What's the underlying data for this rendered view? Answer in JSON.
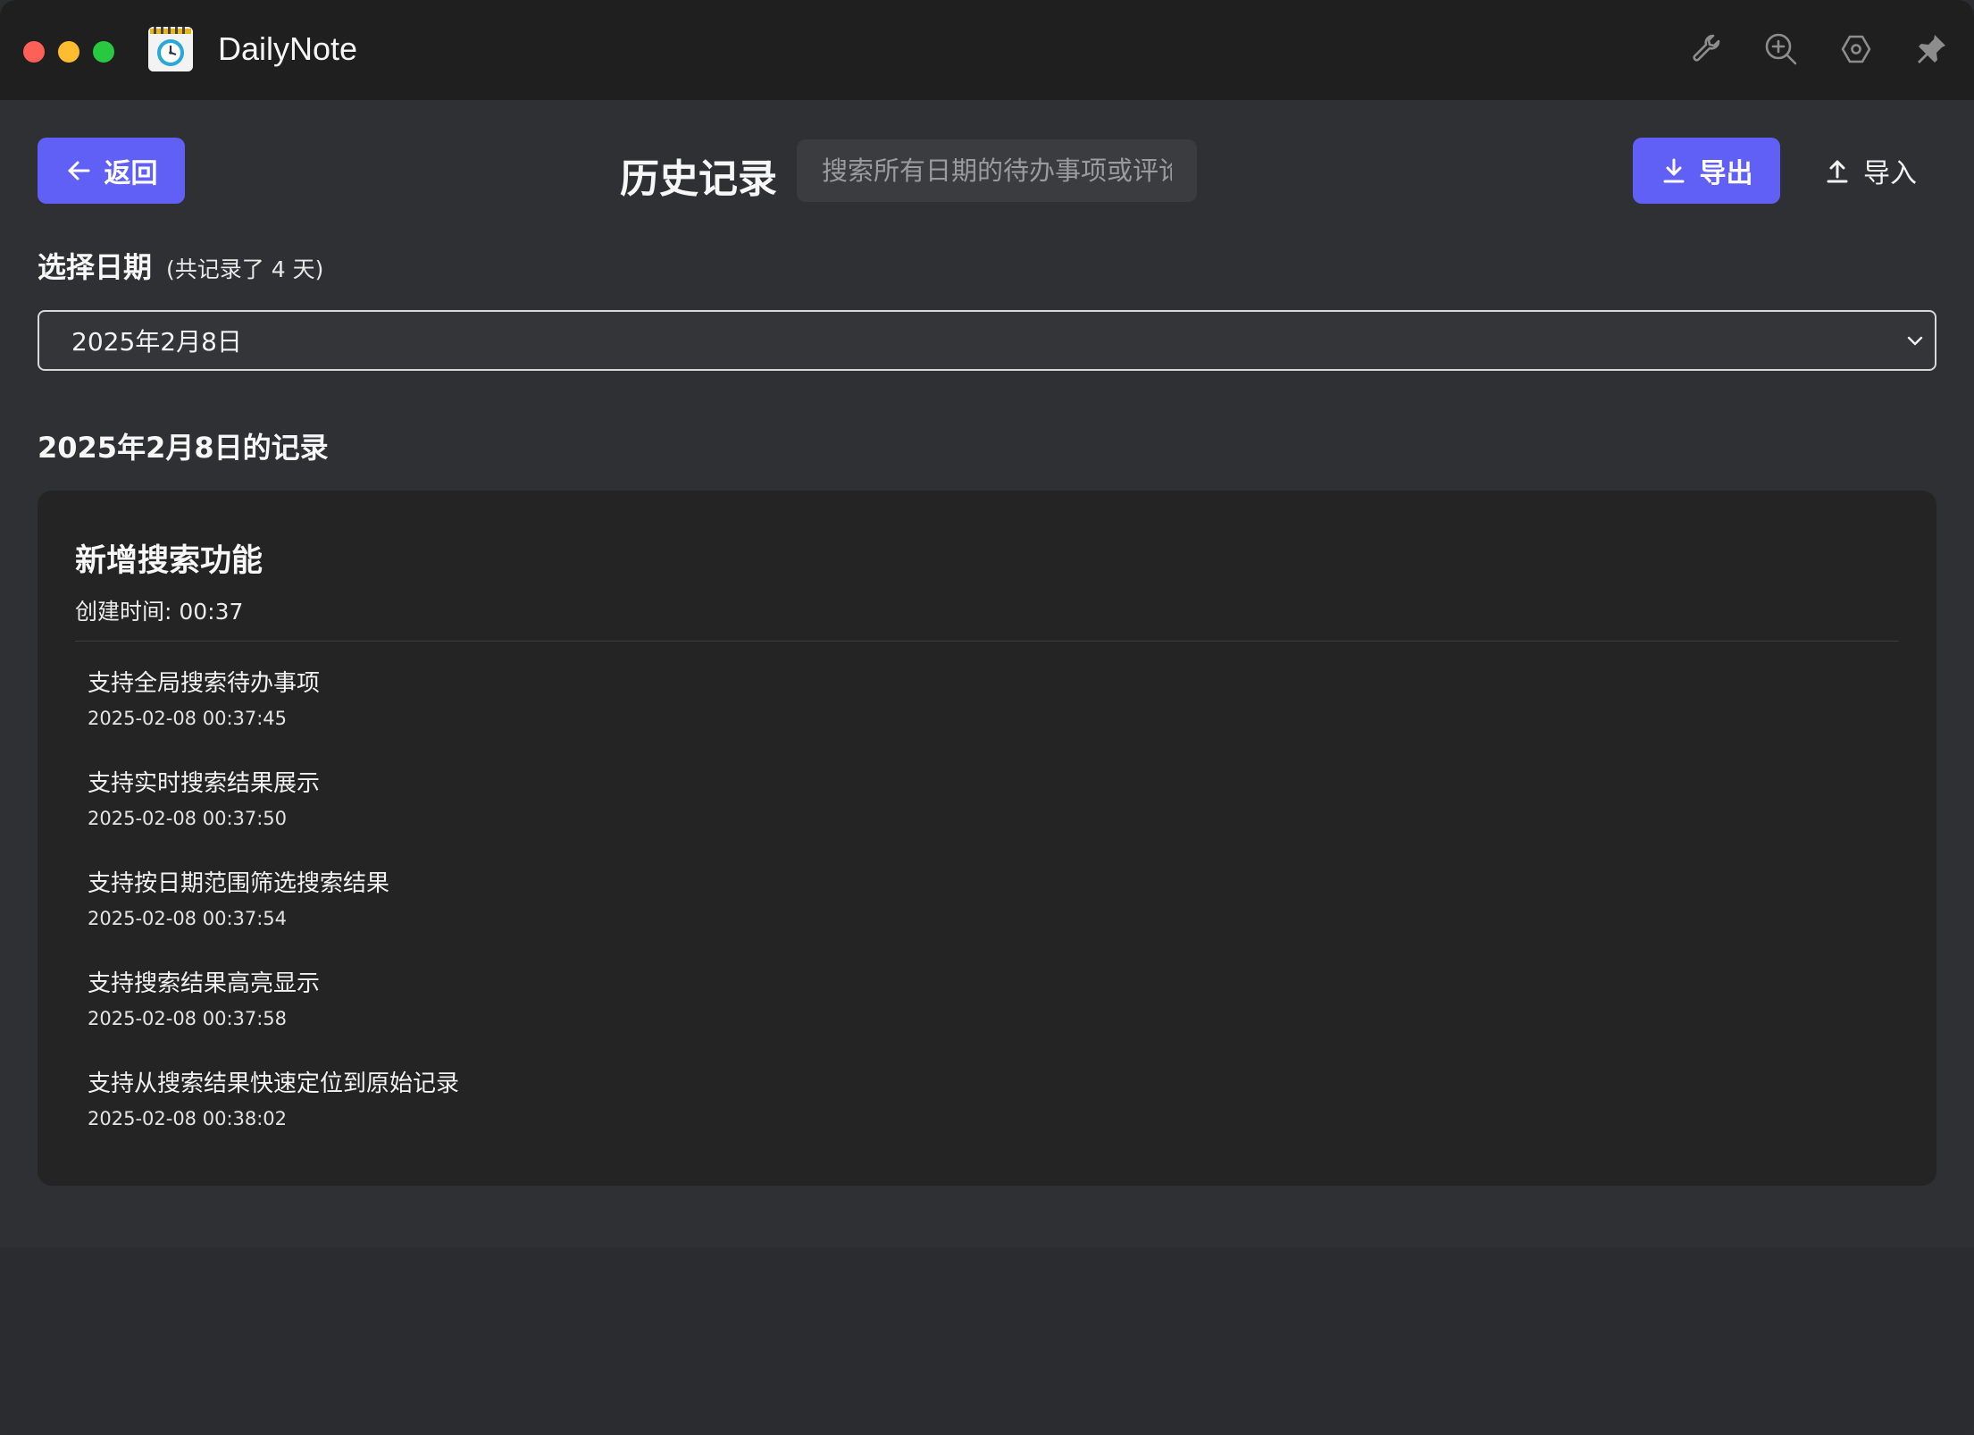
{
  "app": {
    "title": "DailyNote",
    "toolbar_icons": [
      "wrench-icon",
      "zoom-in-icon",
      "settings-hex-icon",
      "pin-icon"
    ]
  },
  "header": {
    "back_label": "返回",
    "page_title": "历史记录",
    "search_placeholder": "搜索所有日期的待办事项或评论",
    "export_label": "导出",
    "import_label": "导入"
  },
  "date_picker": {
    "label": "选择日期",
    "count_note": "(共记录了 4 天)",
    "selected": "2025年2月8日"
  },
  "records": {
    "heading": "2025年2月8日的记录",
    "card": {
      "title": "新增搜索功能",
      "created": "创建时间: 00:37",
      "items": [
        {
          "text": "支持全局搜索待办事项",
          "time": "2025-02-08 00:37:45"
        },
        {
          "text": "支持实时搜索结果展示",
          "time": "2025-02-08 00:37:50"
        },
        {
          "text": "支持按日期范围筛选搜索结果",
          "time": "2025-02-08 00:37:54"
        },
        {
          "text": "支持搜索结果高亮显示",
          "time": "2025-02-08 00:37:58"
        },
        {
          "text": "支持从搜索结果快速定位到原始记录",
          "time": "2025-02-08 00:38:02"
        }
      ]
    }
  },
  "colors": {
    "accent": "#6160f6",
    "titlebar": "#1f1f1f",
    "background": "#2f3033",
    "card": "#242424"
  }
}
